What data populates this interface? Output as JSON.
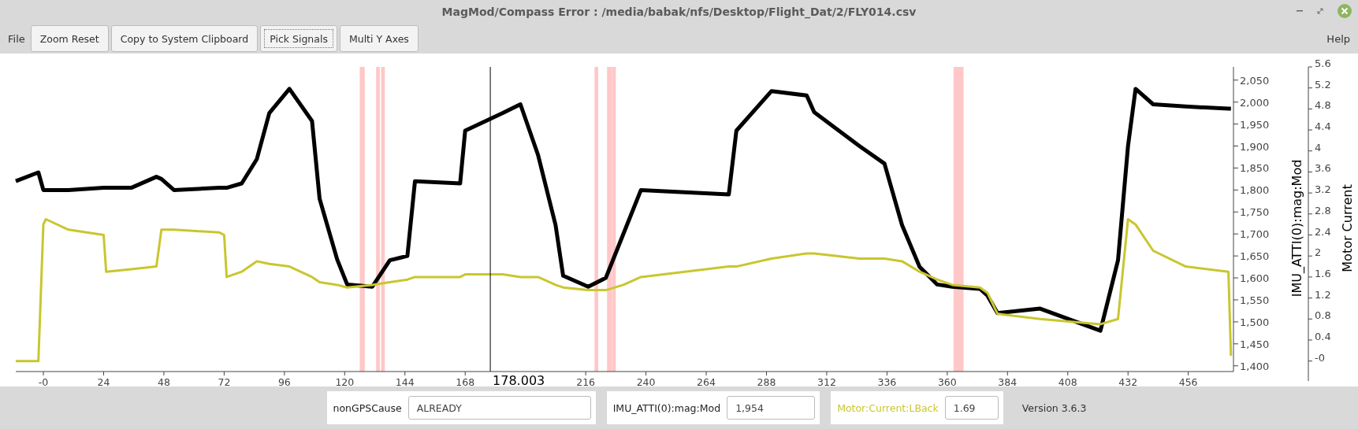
{
  "window": {
    "title": "MagMod/Compass Error : /media/babak/nfs/Desktop/Flight_Dat/2/FLY014.csv"
  },
  "menu_left": "File",
  "toolbar": [
    {
      "label": "Zoom Reset",
      "focused": false
    },
    {
      "label": "Copy to System Clipboard",
      "focused": false
    },
    {
      "label": "Pick Signals",
      "focused": true
    },
    {
      "label": "Multi Y Axes",
      "focused": false
    }
  ],
  "menu_right": "Help",
  "chart": {
    "axis_titles": [
      "IMU_ATTI(0):mag:Mod",
      "Motor Current"
    ],
    "chart_data": {
      "type": "line",
      "x": [
        -11,
        -2,
        0,
        1,
        10,
        24,
        25,
        35,
        45,
        47,
        52,
        70,
        72,
        73,
        79,
        85,
        90,
        98,
        107,
        110,
        117,
        121,
        131,
        138,
        145,
        148,
        166,
        168,
        183,
        190,
        197,
        204,
        207,
        217,
        224,
        231,
        238,
        273,
        276,
        290,
        304,
        307,
        325,
        335,
        342,
        349,
        356,
        362,
        373,
        376,
        380,
        397,
        421,
        428,
        432,
        435,
        442,
        455,
        472,
        473
      ],
      "series": [
        {
          "color": "#000000",
          "values": [
            1820,
            1840,
            1800,
            1800,
            1800,
            1805,
            1805,
            1805,
            1830,
            1825,
            1800,
            1805,
            1805,
            1805,
            1815,
            1870,
            1975,
            2030,
            1957,
            1780,
            1642,
            1585,
            1580,
            1640,
            1650,
            1820,
            1815,
            1935,
            1975,
            1995,
            1880,
            1720,
            1605,
            1580,
            1600,
            1700,
            1800,
            1790,
            1935,
            2025,
            2015,
            1977,
            1900,
            1860,
            1720,
            1625,
            1585,
            1580,
            1575,
            1560,
            1520,
            1530,
            1480,
            1640,
            1900,
            2030,
            1995,
            1990,
            1985,
            1985
          ]
        },
        {
          "color": "#c9c62f",
          "axis": "y2",
          "values": [
            0,
            0,
            2.6,
            2.7,
            2.5,
            2.4,
            1.7,
            1.75,
            1.8,
            2.5,
            2.5,
            2.45,
            2.4,
            1.6,
            1.7,
            1.9,
            1.85,
            1.8,
            1.6,
            1.5,
            1.45,
            1.4,
            1.45,
            1.5,
            1.55,
            1.6,
            1.6,
            1.65,
            1.65,
            1.6,
            1.6,
            1.45,
            1.4,
            1.35,
            1.35,
            1.45,
            1.6,
            1.8,
            1.8,
            1.95,
            2.05,
            2.05,
            1.95,
            1.95,
            1.9,
            1.7,
            1.55,
            1.45,
            1.4,
            1.3,
            0.9,
            0.8,
            0.7,
            0.8,
            2.7,
            2.6,
            2.1,
            1.8,
            1.7,
            0.1
          ]
        }
      ],
      "xlim": [
        -11,
        474
      ],
      "ylim": [
        1387,
        2080
      ],
      "y2lim": [
        -0.2,
        5.6
      ],
      "xticks": [
        {
          "value": 0,
          "label": "-0"
        },
        {
          "value": 24,
          "label": "24"
        },
        {
          "value": 48,
          "label": "48"
        },
        {
          "value": 72,
          "label": "72"
        },
        {
          "value": 96,
          "label": "96"
        },
        {
          "value": 120,
          "label": "120"
        },
        {
          "value": 144,
          "label": "144"
        },
        {
          "value": 168,
          "label": "168"
        },
        {
          "value": 216,
          "label": "216"
        },
        {
          "value": 240,
          "label": "240"
        },
        {
          "value": 264,
          "label": "264"
        },
        {
          "value": 288,
          "label": "288"
        },
        {
          "value": 312,
          "label": "312"
        },
        {
          "value": 336,
          "label": "336"
        },
        {
          "value": 360,
          "label": "360"
        },
        {
          "value": 384,
          "label": "384"
        },
        {
          "value": 408,
          "label": "408"
        },
        {
          "value": 432,
          "label": "432"
        },
        {
          "value": 456,
          "label": "456"
        }
      ],
      "yticks": [
        {
          "value": 1400,
          "label": "1,400"
        },
        {
          "value": 1450,
          "label": "1,450"
        },
        {
          "value": 1500,
          "label": "1,500"
        },
        {
          "value": 1550,
          "label": "1,550"
        },
        {
          "value": 1600,
          "label": "1,600"
        },
        {
          "value": 1650,
          "label": "1,650"
        },
        {
          "value": 1700,
          "label": "1,700"
        },
        {
          "value": 1750,
          "label": "1,750"
        },
        {
          "value": 1800,
          "label": "1,800"
        },
        {
          "value": 1850,
          "label": "1,850"
        },
        {
          "value": 1900,
          "label": "1,900"
        },
        {
          "value": 1950,
          "label": "1,950"
        },
        {
          "value": 2000,
          "label": "2,000"
        },
        {
          "value": 2050,
          "label": "2,050"
        }
      ],
      "y2ticks": [
        {
          "value": 0,
          "label": "-0"
        },
        {
          "value": 0.4,
          "label": "0.4"
        },
        {
          "value": 0.8,
          "label": "0.8"
        },
        {
          "value": 1.2,
          "label": "1.2"
        },
        {
          "value": 1.6,
          "label": "1.6"
        },
        {
          "value": 2,
          "label": "2"
        },
        {
          "value": 2.4,
          "label": "2.4"
        },
        {
          "value": 2.8,
          "label": "2.8"
        },
        {
          "value": 3.2,
          "label": "3.2"
        },
        {
          "value": 3.6,
          "label": "3.6"
        },
        {
          "value": 4,
          "label": "4"
        },
        {
          "value": 4.4,
          "label": "4.4"
        },
        {
          "value": 4.8,
          "label": "4.8"
        },
        {
          "value": 5.2,
          "label": "5.2"
        },
        {
          "value": 5.6,
          "label": "5.6"
        }
      ],
      "bands": [
        {
          "axis": "x",
          "from": 126,
          "to": 128
        },
        {
          "axis": "x",
          "from": 132.5,
          "to": 134
        },
        {
          "axis": "x",
          "from": 134.5,
          "to": 136
        },
        {
          "axis": "x",
          "from": 219.5,
          "to": 221
        },
        {
          "axis": "x",
          "from": 224.5,
          "to": 226.5
        },
        {
          "axis": "x",
          "from": 226.5,
          "to": 228
        },
        {
          "axis": "x",
          "from": 362.5,
          "to": 366.5
        }
      ],
      "ref_lines": [
        {
          "axis": "x",
          "value": 178.003,
          "label": "178.003"
        }
      ]
    }
  },
  "readouts": [
    {
      "label": "nonGPSCause",
      "value": "ALREADY",
      "color": "#222222"
    },
    {
      "label": "IMU_ATTI(0):mag:Mod",
      "value": "1,954",
      "color": "#222222"
    },
    {
      "label": "Motor:Current:LBack",
      "value": "1.69",
      "color": "#c9c62f"
    }
  ],
  "version": "Version 3.6.3"
}
